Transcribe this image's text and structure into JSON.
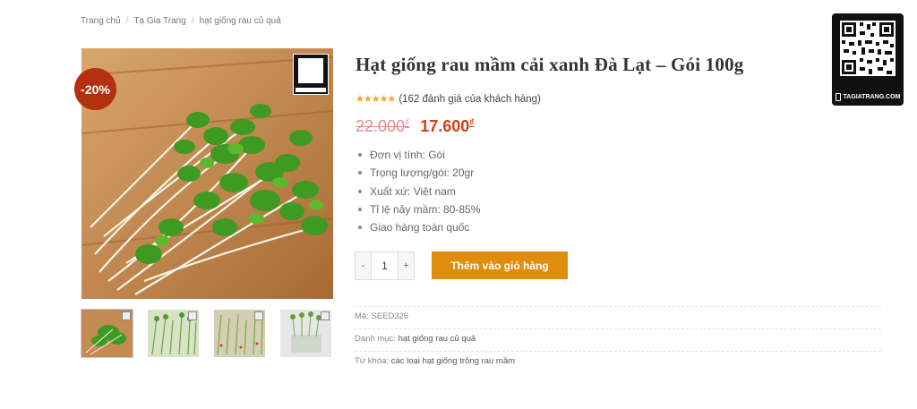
{
  "breadcrumb": {
    "items": [
      "Trang chủ",
      "Tạ Gia Trang",
      "hạt giống rau củ quả"
    ],
    "separator": "/"
  },
  "product": {
    "title": "Hạt giống rau mầm cải xanh Đà Lạt – Gói 100g",
    "sale_badge": "-20%",
    "rating_stars": "★★★★★",
    "rating_text": "(162 đánh giá của khách hàng)",
    "rating_value": 5,
    "old_price": "22.000",
    "new_price": "17.600",
    "currency": "₫",
    "specs": [
      "Đơn vị tính: Gói",
      "Trọng lượng/gói: 20gr",
      "Xuất xứ: Việt nam",
      "Tỉ lệ nảy mầm: 80-85%",
      "Giao hàng toàn quốc"
    ]
  },
  "cart": {
    "minus": "-",
    "quantity": "1",
    "plus": "+",
    "add_button": "Thêm vào giỏ hàng"
  },
  "meta": {
    "sku_label": "Mã:",
    "sku_value": "SEED326",
    "category_label": "Danh mục:",
    "category_value": "hạt giống rau củ quả",
    "tags_label": "Từ khóa:",
    "tags_value": "các loại hạt giống trồng rau mầm"
  },
  "qr": {
    "label": "TAGIATRANG.COM"
  },
  "colors": {
    "badge": "#b5300e",
    "sale_price": "#d33c16",
    "old_price": "#e88a8a",
    "button": "#e08c0c",
    "stars": "#f5a623"
  }
}
